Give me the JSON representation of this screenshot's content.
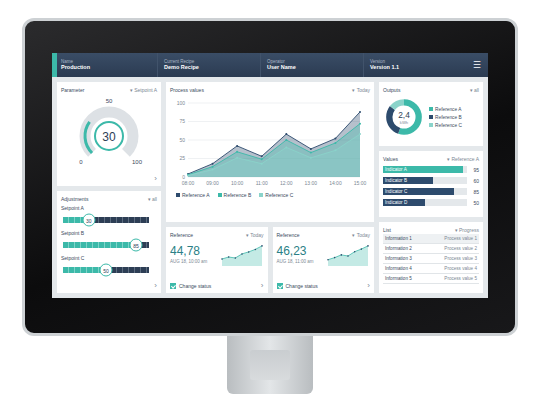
{
  "header": {
    "items": [
      {
        "label": "Name",
        "value": "Production",
        "active": true
      },
      {
        "label": "Current Recipe",
        "value": "Demo Recipe",
        "active": false
      },
      {
        "label": "Operator",
        "value": "User Name",
        "active": false
      },
      {
        "label": "Version",
        "value": "Version 1.1",
        "active": false
      }
    ],
    "menu": "☰"
  },
  "gauge": {
    "title": "Parameter",
    "filter": "▾ Setpoint A",
    "value": "30",
    "level": 0.3,
    "min": "0",
    "mid": "50",
    "max": "100",
    "more": "›"
  },
  "adjustments": {
    "title": "Adjustments",
    "filter": "▾ all",
    "more": "›",
    "sliders": [
      {
        "label": "Setpoint A",
        "value": "30",
        "level": 0.3
      },
      {
        "label": "Setpoint B",
        "value": "85",
        "level": 0.85
      },
      {
        "label": "Setpoint C",
        "value": "50",
        "level": 0.5
      }
    ]
  },
  "chart": {
    "title": "Process values",
    "filter": "▾ Today",
    "y_ticks": [
      "0",
      "25",
      "50",
      "75",
      "100"
    ],
    "x_ticks": [
      "08:00",
      "09:00",
      "10:00",
      "11:00",
      "12:00",
      "13:00",
      "14:00",
      "15:00"
    ],
    "series": [
      {
        "name": "Reference A",
        "color": "#2d4b6d",
        "values": [
          4,
          18,
          42,
          28,
          58,
          38,
          52,
          88
        ]
      },
      {
        "name": "Reference B",
        "color": "#3cb9a9",
        "values": [
          3,
          14,
          34,
          24,
          50,
          33,
          46,
          72
        ]
      },
      {
        "name": "Reference C",
        "color": "#8ad3ca",
        "values": [
          2,
          10,
          26,
          18,
          40,
          26,
          36,
          58
        ]
      }
    ]
  },
  "outputs": {
    "title": "Outputs",
    "filter": "▾ all",
    "value": "2,4",
    "unit": "kWh",
    "segments": [
      {
        "name": "Reference A",
        "level": 0.55,
        "color": "#3cb9a9"
      },
      {
        "name": "Reference B",
        "level": 0.3,
        "color": "#2d4b6d"
      },
      {
        "name": "Reference C",
        "level": 0.15,
        "color": "#8ad3ca"
      }
    ]
  },
  "values": {
    "title": "Values",
    "filter": "▾ Reference A",
    "bars": [
      {
        "label": "Indicator A",
        "value": "95",
        "level": 0.95,
        "color": "#3cb9a9"
      },
      {
        "label": "Indicator B",
        "value": "60",
        "level": 0.6,
        "color": "#2d4b6d"
      },
      {
        "label": "Indicator C",
        "value": "85",
        "level": 0.85,
        "color": "#2d4b6d"
      },
      {
        "label": "Indicator D",
        "value": "50",
        "level": 0.5,
        "color": "#2d4b6d"
      }
    ]
  },
  "references": [
    {
      "title": "Reference",
      "filter": "▾ Today",
      "value": "44,78",
      "time": "AUG 18, 10:00 am",
      "trend": [
        12,
        16,
        14,
        22,
        26,
        31,
        38
      ],
      "checkbox": {
        "label": "Change status",
        "checked": true
      },
      "more": "›"
    },
    {
      "title": "Reference",
      "filter": "▾ Today",
      "value": "46,23",
      "time": "AUG 18, 11:00 am",
      "trend": [
        10,
        14,
        19,
        17,
        25,
        30,
        36
      ],
      "checkbox": {
        "label": "Change status",
        "checked": true
      },
      "more": "›"
    }
  ],
  "list": {
    "title": "List",
    "filter": "▾ Progress",
    "rows": [
      {
        "name": "Information 1",
        "detail": "Process value 1",
        "selected": true
      },
      {
        "name": "Information 2",
        "detail": "Process value 2",
        "selected": false
      },
      {
        "name": "Information 3",
        "detail": "Process value 3",
        "selected": false
      },
      {
        "name": "Information 4",
        "detail": "Process value 4",
        "selected": false
      },
      {
        "name": "Information 5",
        "detail": "Process value 5",
        "selected": false
      }
    ]
  }
}
